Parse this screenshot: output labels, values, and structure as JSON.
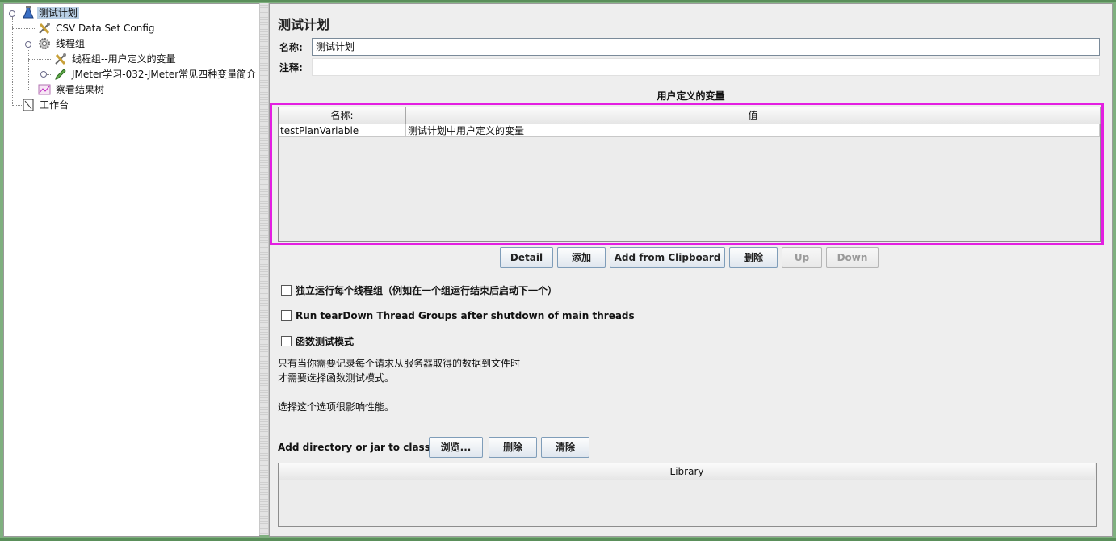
{
  "tree": {
    "items": [
      {
        "label": "测试计划",
        "icon": "test-plan-icon",
        "selected": true
      },
      {
        "label": "CSV Data Set Config",
        "icon": "config-tools-icon"
      },
      {
        "label": "线程组",
        "icon": "gear-icon"
      },
      {
        "label": "线程组--用户定义的变量",
        "icon": "config-tools-icon"
      },
      {
        "label": "JMeter学习-032-JMeter常见四种变量简介",
        "icon": "sampler-pen-icon"
      },
      {
        "label": "察看结果树",
        "icon": "chart-icon"
      },
      {
        "label": "工作台",
        "icon": "workbench-icon"
      }
    ]
  },
  "panel": {
    "title": "测试计划",
    "name_label": "名称:",
    "name_value": "测试计划",
    "comment_label": "注释:",
    "comment_value": ""
  },
  "variables": {
    "title": "用户定义的变量",
    "columns": [
      "名称:",
      "值"
    ],
    "rows": [
      {
        "name": "testPlanVariable",
        "value": "测试计划中用户定义的变量"
      }
    ],
    "highlight_color": "#e31ee1"
  },
  "buttons": {
    "detail": "Detail",
    "add": "添加",
    "add_clipboard": "Add from Clipboard",
    "delete": "删除",
    "up": "Up",
    "down": "Down"
  },
  "options": {
    "serialize": "独立运行每个线程组（例如在一个组运行结束后启动下一个）",
    "teardown": "Run tearDown Thread Groups after shutdown of main threads",
    "functional": "函数测试模式"
  },
  "notes": {
    "line1": "只有当你需要记录每个请求从服务器取得的数据到文件时",
    "line2": "才需要选择函数测试模式。",
    "line3": "选择这个选项很影响性能。"
  },
  "classpath": {
    "label": "Add directory or jar to classpath",
    "browse": "浏览...",
    "delete": "删除",
    "clear": "清除",
    "library_header": "Library"
  }
}
